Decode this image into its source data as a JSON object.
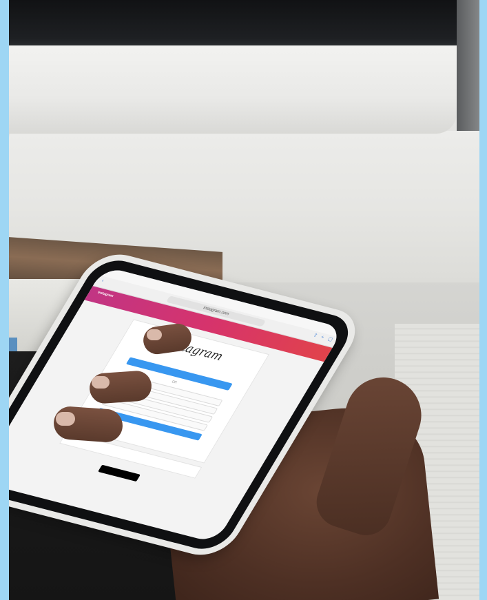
{
  "photo": {
    "accent_frame_color": "#9ed6f4",
    "scene_elements": [
      "monitor",
      "paper-stack",
      "hand",
      "smartphone"
    ]
  },
  "phone": {
    "status_time": "",
    "url": "instagram.com",
    "banner": {
      "title": "Instagram",
      "subtitle": "",
      "action": ""
    },
    "login_card": {
      "logo": "Instagram",
      "tagline": "",
      "facebook_button": "",
      "or_label": "OR",
      "fields": [
        {
          "placeholder": ""
        },
        {
          "placeholder": ""
        },
        {
          "placeholder": ""
        },
        {
          "placeholder": ""
        }
      ],
      "signup_button": "",
      "terms": ""
    },
    "login_prompt": {
      "text": "",
      "link": ""
    },
    "get_app": "",
    "app_store_badge": "",
    "footer_links": ""
  }
}
